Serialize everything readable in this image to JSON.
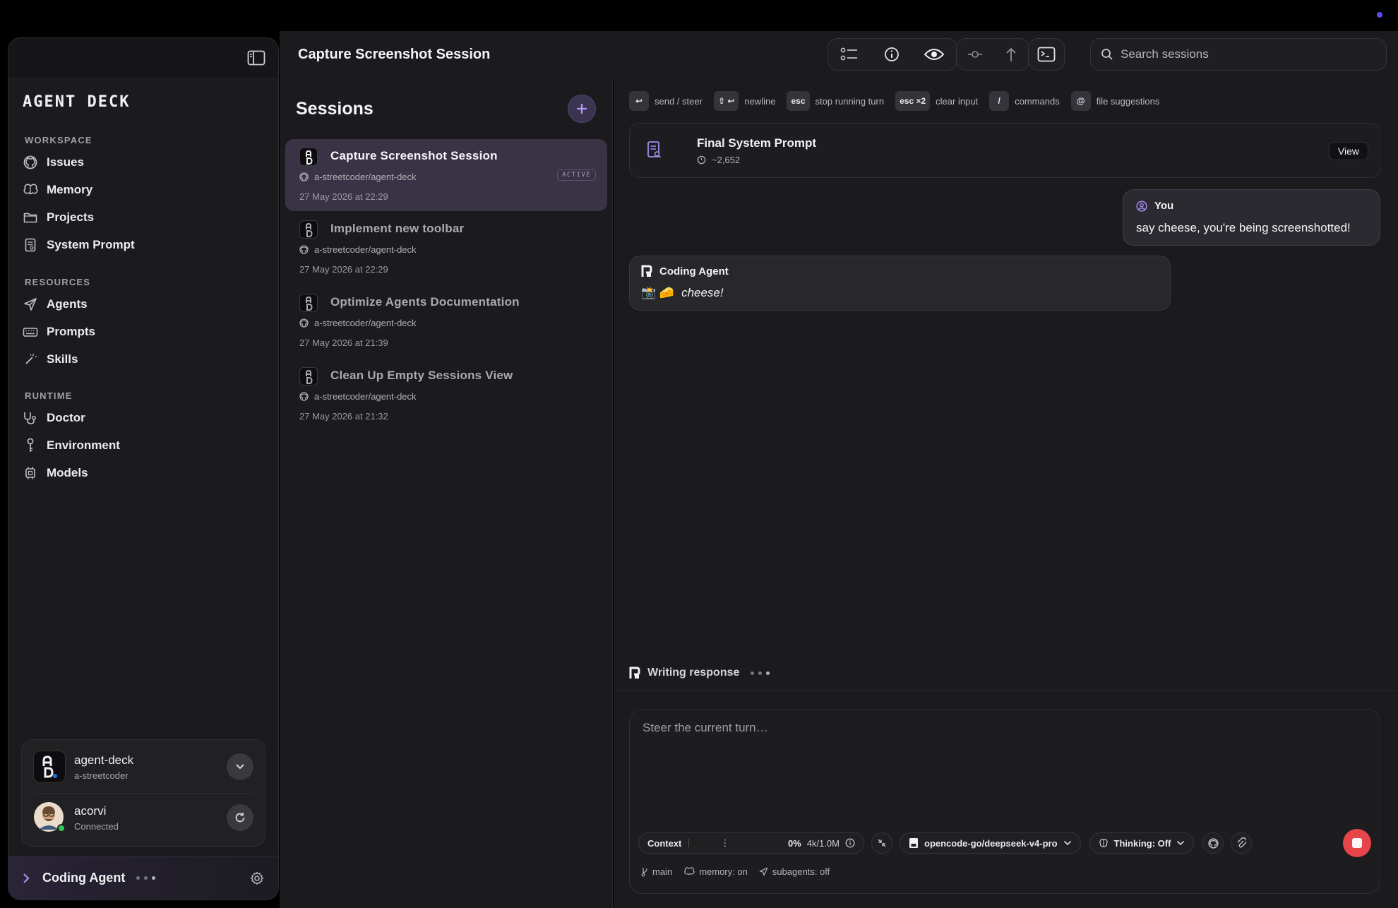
{
  "app": {
    "logo_text": "AGENT DECK",
    "accent_color": "#a48cf2",
    "stop_color": "#e8454a"
  },
  "sidebar": {
    "sections": [
      {
        "label": "WORKSPACE",
        "items": [
          {
            "label": "Issues",
            "icon": "github-icon"
          },
          {
            "label": "Memory",
            "icon": "brain-icon"
          },
          {
            "label": "Projects",
            "icon": "folder-icon"
          },
          {
            "label": "System Prompt",
            "icon": "document-icon"
          }
        ]
      },
      {
        "label": "RESOURCES",
        "items": [
          {
            "label": "Agents",
            "icon": "send-icon"
          },
          {
            "label": "Prompts",
            "icon": "keyboard-icon"
          },
          {
            "label": "Skills",
            "icon": "wand-icon"
          }
        ]
      },
      {
        "label": "RUNTIME",
        "items": [
          {
            "label": "Doctor",
            "icon": "stethoscope-icon"
          },
          {
            "label": "Environment",
            "icon": "key-icon"
          },
          {
            "label": "Models",
            "icon": "chip-icon"
          }
        ]
      }
    ],
    "workspace": {
      "name": "agent-deck",
      "owner": "a-streetcoder"
    },
    "user": {
      "name": "acorvi",
      "status": "Connected"
    },
    "agent_footer": {
      "label": "Coding Agent"
    }
  },
  "header": {
    "title": "Capture Screenshot Session",
    "search_placeholder": "Search sessions"
  },
  "sessions": {
    "title": "Sessions",
    "items": [
      {
        "name": "Capture Screenshot Session",
        "repo": "a-streetcoder/agent-deck",
        "date": "27 May 2026 at 22:29",
        "badge": "ACTIVE"
      },
      {
        "name": "Implement new toolbar",
        "repo": "a-streetcoder/agent-deck",
        "date": "27 May 2026 at 22:29"
      },
      {
        "name": "Optimize Agents Documentation",
        "repo": "a-streetcoder/agent-deck",
        "date": "27 May 2026 at 21:39"
      },
      {
        "name": "Clean Up Empty Sessions View",
        "repo": "a-streetcoder/agent-deck",
        "date": "27 May 2026 at 21:32"
      }
    ]
  },
  "chat": {
    "hints": [
      {
        "key": "↩",
        "label": "send / steer"
      },
      {
        "key": "⇧ ↩",
        "label": "newline"
      },
      {
        "key": "esc",
        "label": "stop running turn"
      },
      {
        "key": "esc ×2",
        "label": "clear input"
      },
      {
        "key": "/",
        "label": "commands"
      },
      {
        "key": "@",
        "label": "file suggestions"
      }
    ],
    "prompt_card": {
      "title": "Final System Prompt",
      "tokens": "~2,652",
      "view_label": "View"
    },
    "user_message": {
      "author": "You",
      "text": "say cheese, you're being screenshotted!"
    },
    "agent_message": {
      "author": "Coding Agent",
      "emoji": "📸 🧀",
      "text": "cheese!"
    },
    "writing_status": "Writing response",
    "composer": {
      "placeholder": "Steer the current turn…",
      "context_label": "Context",
      "context_percent": "0%",
      "context_tokens": "4k/1.0M",
      "model": "opencode-go/deepseek-v4-pro",
      "thinking": "Thinking: Off",
      "status": {
        "branch": "main",
        "memory": "memory: on",
        "subagents": "subagents: off"
      }
    }
  }
}
